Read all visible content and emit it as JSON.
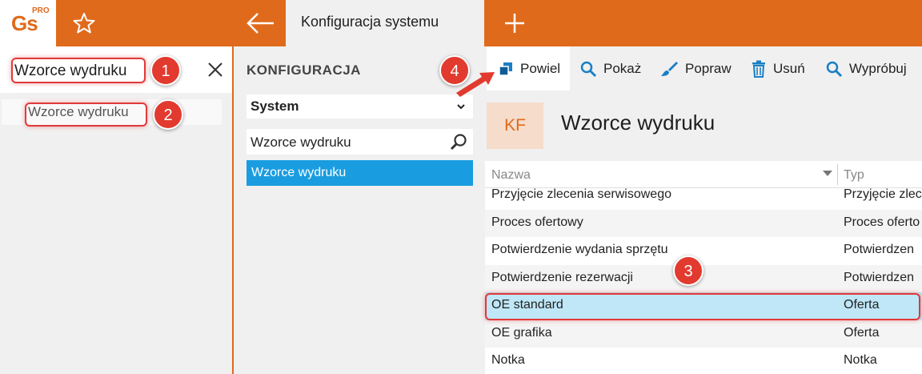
{
  "header": {
    "logo_text": "Gs",
    "logo_superscript": "PRO",
    "active_tab": "Konfiguracja systemu",
    "accent": "#e06a1b"
  },
  "left_panel": {
    "search_value": "Wzorce wydruku",
    "result": "Wzorce wydruku"
  },
  "config": {
    "title": "KONFIGURACJA",
    "group": "System",
    "filter_value": "Wzorce wydruku",
    "selected_item": "Wzorce wydruku"
  },
  "toolbar": {
    "duplicate": "Powiel",
    "show": "Pokaż",
    "edit": "Popraw",
    "delete": "Usuń",
    "try": "Wypróbuj"
  },
  "page": {
    "badge": "KF",
    "title": "Wzorce wydruku"
  },
  "grid": {
    "columns": [
      "Nazwa",
      "Typ"
    ],
    "rows": [
      {
        "name": "Przyjęcie zlecenia serwisowego",
        "type": "Przyjęcie zlece"
      },
      {
        "name": "Proces ofertowy",
        "type": "Proces oferto"
      },
      {
        "name": "Potwierdzenie wydania sprzętu",
        "type": "Potwierdzen"
      },
      {
        "name": "Potwierdzenie rezerwacji",
        "type": "Potwierdzen"
      },
      {
        "name": "OE standard",
        "type": "Oferta"
      },
      {
        "name": "OE grafika",
        "type": "Oferta"
      },
      {
        "name": "Notka",
        "type": "Notka"
      }
    ],
    "selected_index": 4
  },
  "annotations": {
    "step1": "1",
    "step2": "2",
    "step3": "3",
    "step4": "4",
    "marker_color": "#e23a2e"
  }
}
